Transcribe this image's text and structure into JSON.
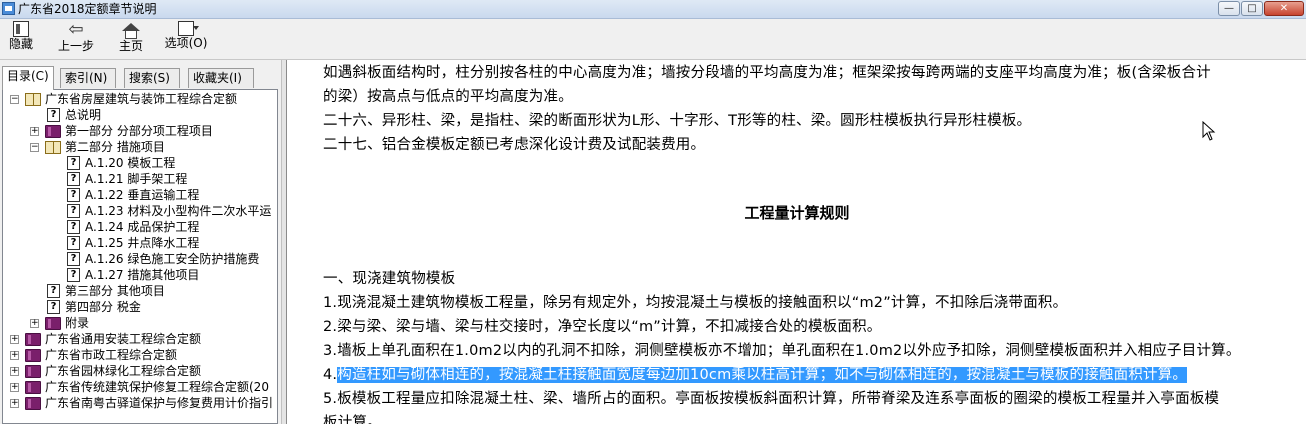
{
  "window": {
    "title": "广东省2018定额章节说明",
    "buttons": {
      "minimize": "—",
      "maximize": "□",
      "close": "✕"
    }
  },
  "toolbar": {
    "hide": "隐藏",
    "back": "上一步",
    "home": "主页",
    "options": "选项(O)"
  },
  "tabs": [
    "目录(C)",
    "索引(N)",
    "搜索(S)",
    "收藏夹(I)"
  ],
  "tree": {
    "root": "广东省房屋建筑与装饰工程综合定额",
    "general": "总说明",
    "part1": "第一部分 分部分项工程项目",
    "part2": "第二部分 措施项目",
    "items": [
      "A.1.20 模板工程",
      "A.1.21 脚手架工程",
      "A.1.22 垂直运输工程",
      "A.1.23 材料及小型构件二次水平运",
      "A.1.24 成品保护工程",
      "A.1.25 井点降水工程",
      "A.1.26 绿色施工安全防护措施费",
      "A.1.27 措施其他项目"
    ],
    "part3": "第三部分 其他项目",
    "part4": "第四部分 税金",
    "appendix": "附录",
    "others": [
      "广东省通用安装工程综合定额",
      "广东省市政工程综合定额",
      "广东省园林绿化工程综合定额",
      "广东省传统建筑保护修复工程综合定额(20",
      "广东省南粤古驿道保护与修复费用计价指引"
    ]
  },
  "content": {
    "lines_top": [
      "如遇斜板面结构时，柱分别按各柱的中心高度为准；墙按分段墙的平均高度为准；框架梁按每跨两端的支座平均高度为准；板(含梁板合计",
      "的梁）按高点与低点的平均高度为准。",
      "二十六、异形柱、梁，是指柱、梁的断面形状为L形、十字形、T形等的柱、梁。圆形柱模板执行异形柱模板。",
      "二十七、铝合金模板定额已考虑深化设计费及试配装费用。"
    ],
    "heading": "工程量计算规则",
    "section": "一、现浇建筑物模板",
    "rule1": "1.现浇混凝土建筑物模板工程量，除另有规定外，均按混凝土与模板的接触面积以“m2”计算，不扣除后浇带面积。",
    "rule2": "2.梁与梁、梁与墙、梁与柱交接时，净空长度以“m”计算，不扣减接合处的模板面积。",
    "rule3": "3.墙板上单孔面积在1.0m2以内的孔洞不扣除，洞侧壁模板亦不增加；单孔面积在1.0m2以外应予扣除，洞侧壁模板面积并入相应子目计算。",
    "rule4_num": "4.",
    "rule4_text": "构造柱如与砌体相连的，按混凝土柱接触面宽度每边加10cm乘以柱高计算；如不与砌体相连的，按混凝土与模板的接触面积计算。",
    "rule5": "5.板模板工程量应扣除混凝土柱、梁、墙所占的面积。亭面板按模板斜面积计算，所带脊梁及连系亭面板的圈梁的模板工程量并入亭面板模",
    "rule5_cont": "板计算。"
  },
  "colors": {
    "highlight": "#3399ff",
    "book_closed": "#7a1f6b"
  }
}
